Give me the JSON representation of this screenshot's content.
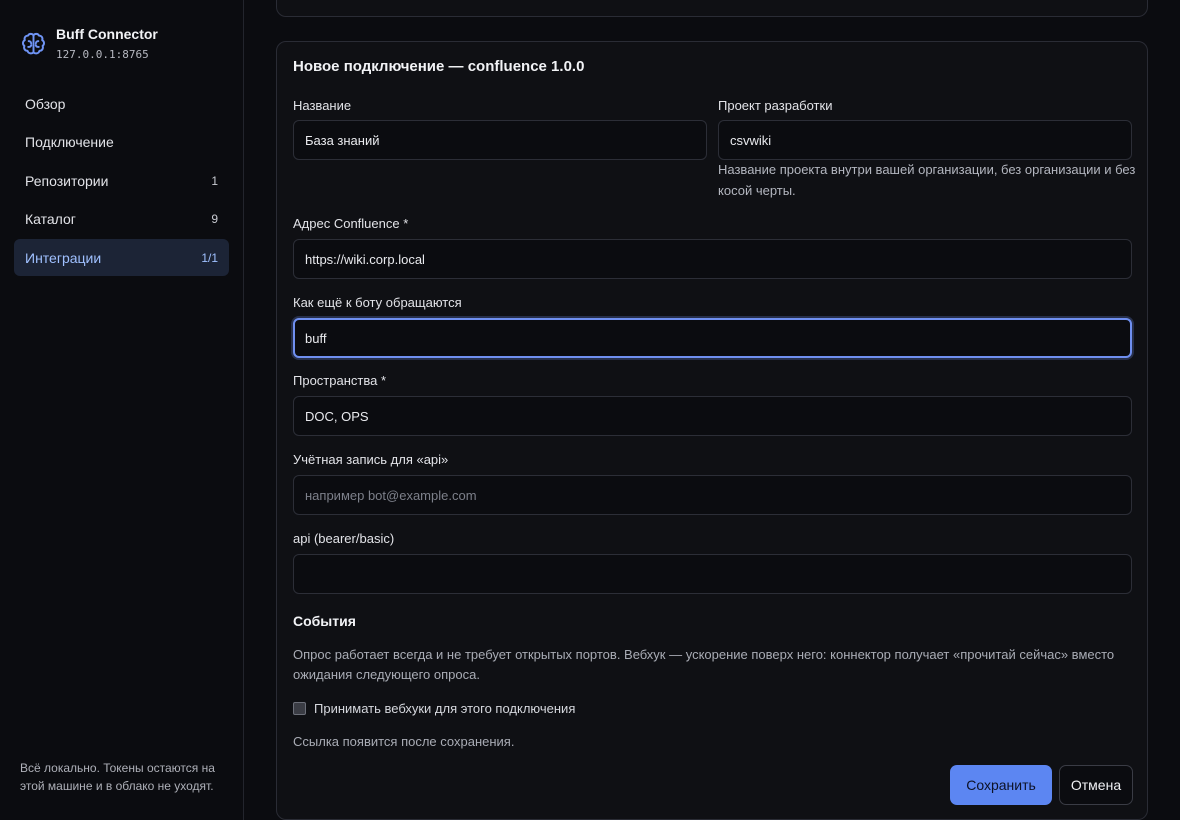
{
  "brand": {
    "name": "Buff Connector",
    "address": "127.0.0.1:8765",
    "icon": "brain-icon",
    "accent": "#5c86f2"
  },
  "nav": {
    "items": [
      {
        "label": "Обзор",
        "count": ""
      },
      {
        "label": "Подключение",
        "count": ""
      },
      {
        "label": "Репозитории",
        "count": "1"
      },
      {
        "label": "Каталог",
        "count": "9"
      },
      {
        "label": "Интеграции",
        "count": "1/1",
        "active": true
      }
    ]
  },
  "sidebar_footer": "Всё локально. Токены остаются на этой машине и в облако не уходят.",
  "form": {
    "title": "Новое подключение — confluence 1.0.0",
    "name": {
      "label": "Название",
      "value": "База знаний"
    },
    "project": {
      "label": "Проект разработки",
      "value": "csvwiki",
      "hint": "Название проекта внутри вашей организации, без организации и без косой черты."
    },
    "url": {
      "label": "Адрес Confluence *",
      "value": "https://wiki.corp.local"
    },
    "aliases": {
      "label": "Как ещё к боту обращаются",
      "value": "buff"
    },
    "spaces": {
      "label": "Пространства *",
      "value": "DOC, OPS"
    },
    "account": {
      "label": "Учётная запись для «api»",
      "value": "",
      "placeholder": "например bot@example.com"
    },
    "token": {
      "label": "api (bearer/basic)",
      "value": ""
    },
    "events": {
      "title": "События",
      "description": "Опрос работает всегда и не требует открытых портов. Вебхук — ускорение поверх него: коннектор получает «прочитай сейчас» вместо ожидания следующего опроса.",
      "checkbox_label": "Принимать вебхуки для этого подключения",
      "checked": false,
      "after_save": "Ссылка появится после сохранения."
    },
    "save_label": "Сохранить",
    "cancel_label": "Отмена"
  }
}
